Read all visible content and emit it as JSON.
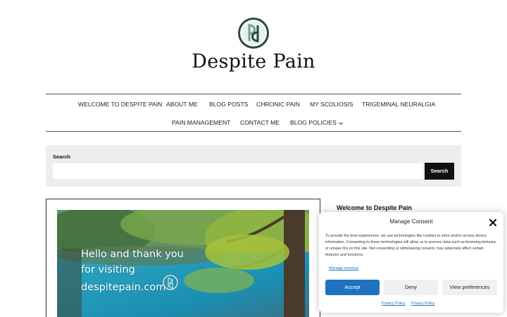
{
  "site": {
    "title": "Despite Pain"
  },
  "nav": {
    "row1": [
      "WELCOME TO DESPITE PAIN",
      "ABOUT ME",
      "BLOG POSTS",
      "CHRONIC PAIN",
      "MY SCOLIOSIS",
      "TRIGEMINAL NEURALGIA"
    ],
    "row2": [
      "PAIN MANAGEMENT",
      "CONTACT ME",
      "BLOG POLICIES"
    ]
  },
  "search": {
    "label": "Search",
    "value": "",
    "placeholder": "",
    "button": "Search"
  },
  "featured": {
    "line1": "Hello and thank you",
    "line2": "for visiting",
    "line3": "despitepain.com"
  },
  "sidebar": {
    "title": "Welcome to Despite Pain"
  },
  "consent": {
    "title": "Manage Consent",
    "body": "To provide the best experiences, we use technologies like cookies to store and/or access device information. Consenting to these technologies will allow us to process data such as browsing behavior or unique IDs on this site. Not consenting or withdrawing consent, may adversely affect certain features and functions.",
    "manage_link": "Manage services",
    "accept": "Accept",
    "deny": "Deny",
    "preferences": "View preferences",
    "privacy1": "Privacy Policy",
    "privacy2": "Privacy Policy"
  },
  "colors": {
    "accent": "#1e73be",
    "logo_green": "#6fa38a",
    "text": "#222222"
  },
  "icons": [
    "dp-logo-icon",
    "chevron-down-icon",
    "close-icon"
  ]
}
